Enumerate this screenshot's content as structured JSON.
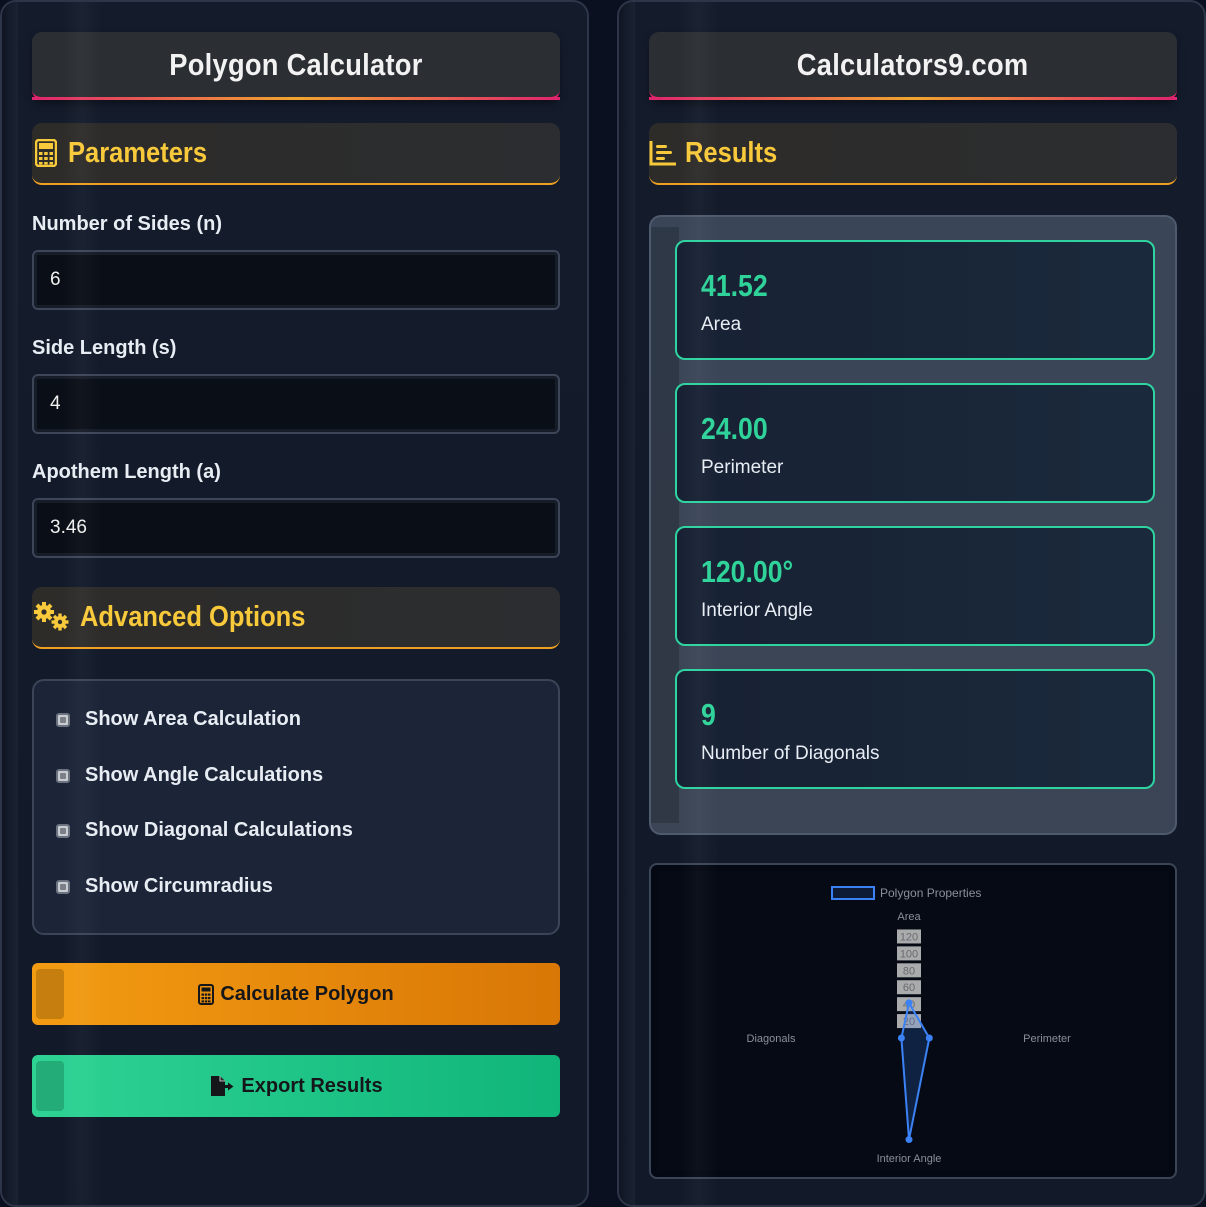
{
  "left_panel": {
    "title": "Polygon Calculator",
    "parameters_heading": "Parameters",
    "fields": [
      {
        "label": "Number of Sides (n)",
        "value": "6"
      },
      {
        "label": "Side Length (s)",
        "value": "4"
      },
      {
        "label": "Apothem Length (a)",
        "value": "3.46"
      }
    ],
    "advanced_heading": "Advanced Options",
    "options": [
      {
        "label": "Show Area Calculation"
      },
      {
        "label": "Show Angle Calculations"
      },
      {
        "label": "Show Diagonal Calculations"
      },
      {
        "label": "Show Circumradius"
      }
    ],
    "calculate_label": "Calculate Polygon",
    "export_label": "Export Results"
  },
  "right_panel": {
    "title": "Calculators9.com",
    "results_heading": "Results",
    "results": [
      {
        "value": "41.52",
        "label": "Area"
      },
      {
        "value": "24.00",
        "label": "Perimeter"
      },
      {
        "value": "120.00°",
        "label": "Interior Angle"
      },
      {
        "value": "9",
        "label": "Number of Diagonals"
      }
    ]
  },
  "chart_data": {
    "type": "radar",
    "series": [
      {
        "name": "Polygon Properties",
        "values": [
          41.52,
          24.0,
          120.0,
          9
        ]
      }
    ],
    "categories": [
      "Area",
      "Perimeter",
      "Interior Angle",
      "Diagonals"
    ],
    "ticks": [
      "20",
      "40",
      "60",
      "80",
      "100",
      "120"
    ],
    "rmax": 130,
    "color": "#3b82f6"
  }
}
